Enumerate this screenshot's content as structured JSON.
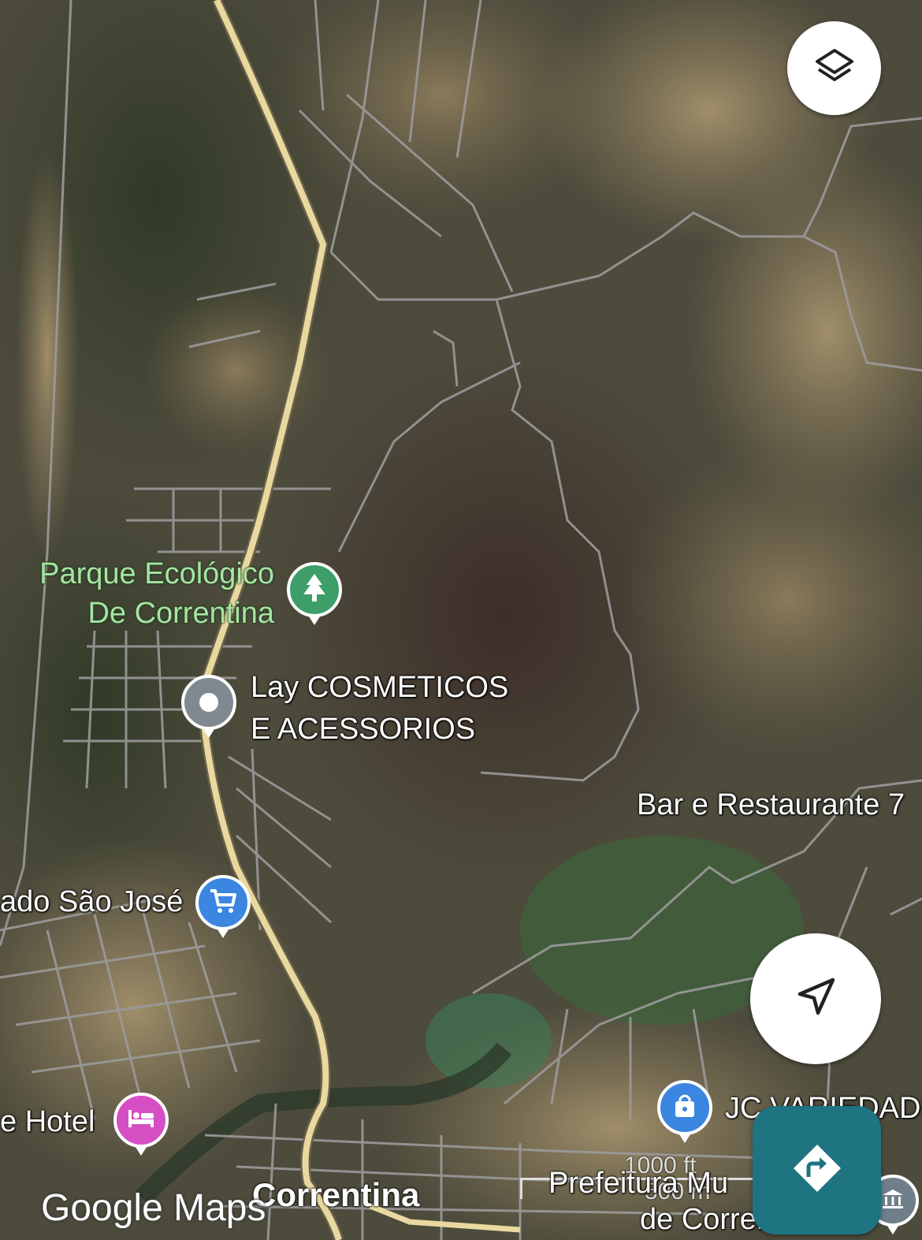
{
  "map": {
    "type": "satellite",
    "buttons": {
      "layers_icon": "layers-icon",
      "location_icon": "navigation-arrow-icon",
      "directions_icon": "directions-icon"
    },
    "labels": {
      "park": {
        "line1": "Parque Ecológico",
        "line2": "De Correntina",
        "icon": "tree-icon"
      },
      "store": {
        "line1": "Lay COSMETICOS",
        "line2": "E ACESSORIOS",
        "icon": "place-dot-icon"
      },
      "restaurant": "Bar e Restaurante 7",
      "market": {
        "text": "ado São José",
        "icon": "shopping-cart-icon"
      },
      "hotel": {
        "text": "e Hotel",
        "icon": "bed-icon"
      },
      "shop": {
        "text": "JC VARIEDADE",
        "icon": "shopping-bag-icon"
      },
      "city": "Correntina",
      "prefeitura": {
        "line1": "Prefeitura Mu",
        "line2": "de Correntina"
      },
      "gov_icon": "government-building-icon"
    },
    "scale": {
      "imperial": "1000 ft",
      "metric": "500 m"
    },
    "attribution": "Google Maps",
    "colors": {
      "highway": "#e8d9a0",
      "road": "#9a9a9a",
      "park_label": "#a7e3a2",
      "park_pin": "#3e9e6a",
      "place_pin": "#808890",
      "shop_pin": "#3a86e0",
      "hotel_pin": "#d54ec4",
      "directions_button": "#1f7481"
    }
  }
}
